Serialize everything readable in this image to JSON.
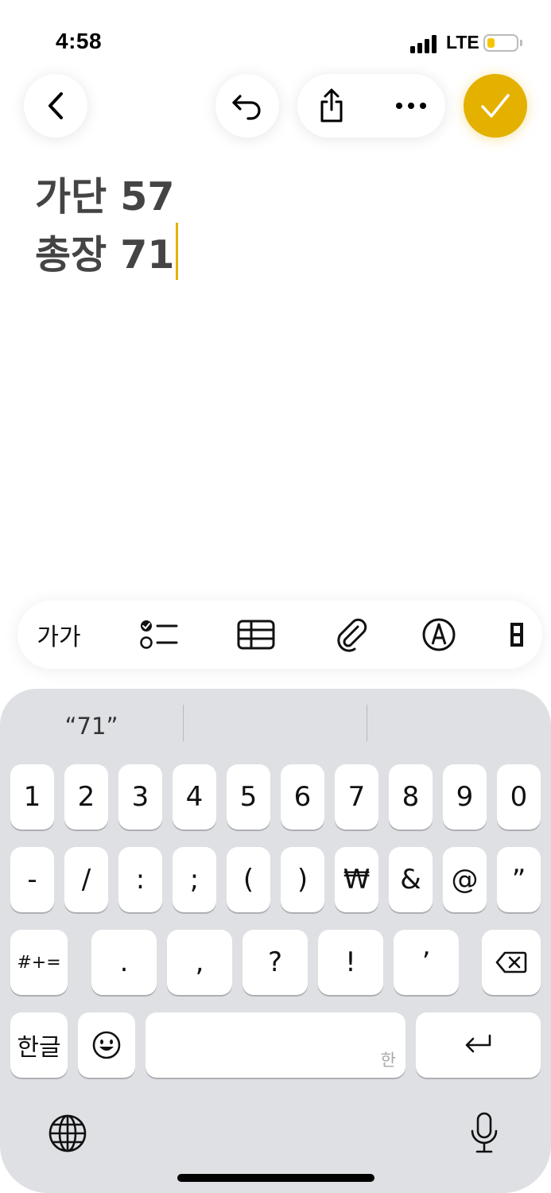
{
  "status_bar": {
    "time": "4:58",
    "network": "LTE",
    "battery_icon": "battery-low-icon"
  },
  "toolbar": {
    "back_icon": "chevron-left-icon",
    "undo_icon": "undo-icon",
    "share_icon": "share-icon",
    "more_icon": "ellipsis-icon",
    "done_icon": "checkmark-icon"
  },
  "note": {
    "lines": [
      "가단 57",
      "총장 71"
    ]
  },
  "format_toolbar": {
    "text_style_label": "가가",
    "items": [
      "checklist-icon",
      "table-icon",
      "attachment-icon",
      "markup-pen-icon",
      "apple-intelligence-icon"
    ]
  },
  "keyboard": {
    "suggestion": "“71”",
    "row1": [
      "1",
      "2",
      "3",
      "4",
      "5",
      "6",
      "7",
      "8",
      "9",
      "0"
    ],
    "row2": [
      "-",
      "/",
      ":",
      ";",
      "(",
      ")",
      "₩",
      "&",
      "@",
      "”"
    ],
    "row3_shift": "#+=",
    "row3": [
      ".",
      ",",
      "?",
      "!",
      "’"
    ],
    "lang_key": "한글",
    "space_hint": "한",
    "emoji_icon": "emoji-icon",
    "return_icon": "return-icon",
    "globe_icon": "globe-icon",
    "mic_icon": "microphone-icon",
    "delete_icon": "delete-icon"
  },
  "colors": {
    "accent": "#e4b100",
    "text": "#444444",
    "keyboard_bg": "#dfe0e4"
  }
}
